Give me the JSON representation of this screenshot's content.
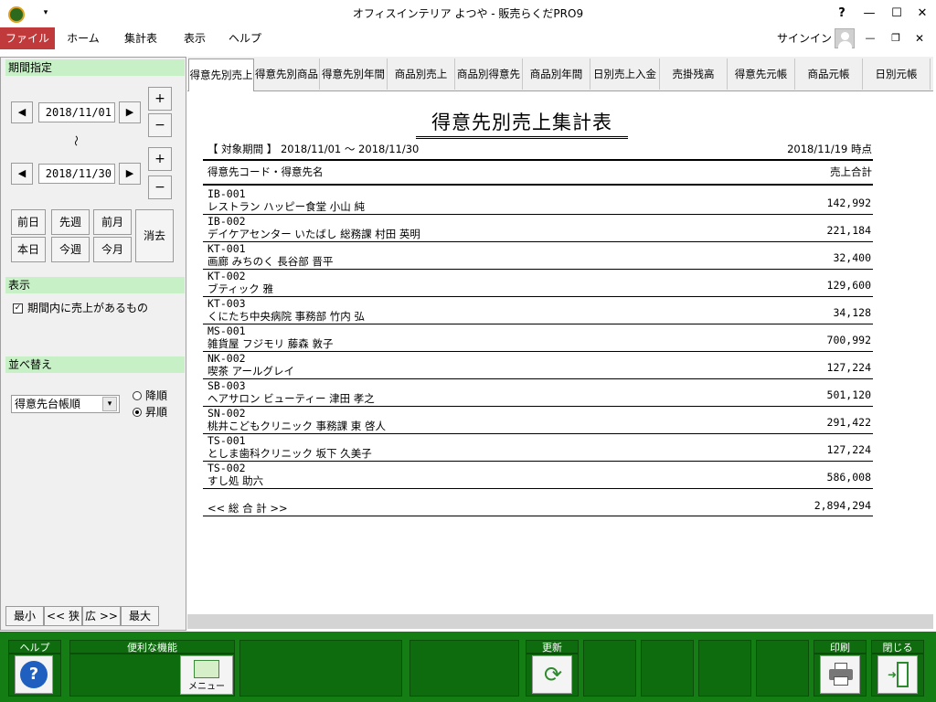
{
  "window": {
    "title": "オフィスインテリア よつや - 販売らくだPRO9",
    "help": "?",
    "minimize": "—",
    "maximize": "☐",
    "close": "✕"
  },
  "ribbon": {
    "file": "ファイル",
    "tabs": [
      "ホーム",
      "集計表",
      "表示",
      "ヘルプ"
    ],
    "signin": "サインイン"
  },
  "left": {
    "period_header": "期間指定",
    "date_from": "2018/11/01",
    "date_to": "2018/11/30",
    "tilde": "～",
    "plus": "+",
    "minus": "−",
    "prev": "◀",
    "next": "▶",
    "quick": {
      "prev_day": "前日",
      "prev_week": "先週",
      "prev_month": "前月",
      "today": "本日",
      "this_week": "今週",
      "this_month": "今月",
      "clear": "消去"
    },
    "display_header": "表示",
    "display_option": "期間内に売上があるもの",
    "sort_header": "並べ替え",
    "sort_value": "得意先台帳順",
    "desc": "降順",
    "asc": "昇順",
    "zoom": [
      "最小",
      "<< 狭",
      "広 >>",
      "最大"
    ]
  },
  "report_tabs": [
    "得意先別売上",
    "得意先別商品",
    "得意先別年間",
    "商品別売上",
    "商品別得意先",
    "商品別年間",
    "日別売上入金",
    "売掛残高",
    "得意先元帳",
    "商品元帳",
    "日別元帳"
  ],
  "report": {
    "title": "得意先別売上集計表",
    "period_label": "【 対象期間 】 2018/11/01 ～ 2018/11/30",
    "as_of": "2018/11/19 時点",
    "col_customer": "得意先コード・得意先名",
    "col_total": "売上合計",
    "rows": [
      {
        "code": "IB-001",
        "name": "レストラン ハッピー食堂 小山 純",
        "amount": "142,992"
      },
      {
        "code": "IB-002",
        "name": "デイケアセンター いたばし 総務課 村田 英明",
        "amount": "221,184"
      },
      {
        "code": "KT-001",
        "name": "画廊 みちのく 長谷部 晋平",
        "amount": "32,400"
      },
      {
        "code": "KT-002",
        "name": "ブティック 雅",
        "amount": "129,600"
      },
      {
        "code": "KT-003",
        "name": "くにたち中央病院 事務部 竹内 弘",
        "amount": "34,128"
      },
      {
        "code": "MS-001",
        "name": "雑貨屋 フジモリ 藤森 敦子",
        "amount": "700,992"
      },
      {
        "code": "NK-002",
        "name": "喫茶 アールグレイ",
        "amount": "127,224"
      },
      {
        "code": "SB-003",
        "name": "ヘアサロン ビューティー 津田 孝之",
        "amount": "501,120"
      },
      {
        "code": "SN-002",
        "name": "桃井こどもクリニック 事務課 東 啓人",
        "amount": "291,422"
      },
      {
        "code": "TS-001",
        "name": "としま歯科クリニック 坂下 久美子",
        "amount": "127,224"
      },
      {
        "code": "TS-002",
        "name": "すし処 助六",
        "amount": "586,008"
      }
    ],
    "total_label": "<< 総 合 計 >>",
    "total_value": "2,894,294"
  },
  "bottom": {
    "help_label": "ヘルプ",
    "features_label": "便利な機能",
    "menu_label": "メニュー",
    "refresh_label": "更新",
    "print_label": "印刷",
    "close_label": "閉じる"
  },
  "colors": {
    "file_tab": "#c0393b",
    "section_header": "#c7f0c7",
    "bottom_bar": "#147e14"
  }
}
